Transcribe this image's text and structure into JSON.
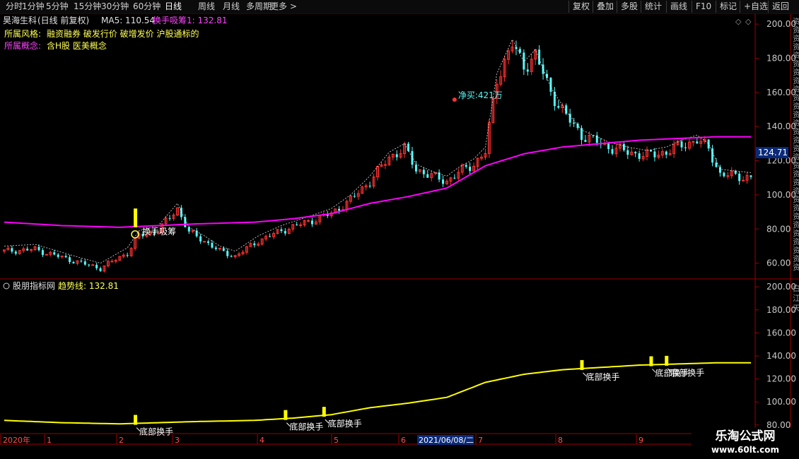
{
  "toolbar": {
    "left_items": [
      "分时",
      "1分钟",
      "5分钟",
      "15分钟",
      "30分钟",
      "60分钟",
      "日线",
      "周线",
      "月线",
      "多周期",
      "更多 >"
    ],
    "active": "日线",
    "right_items": [
      "复权",
      "叠加",
      "多股",
      "统计",
      "画线",
      "F10",
      "标记",
      "+自选",
      "返回"
    ]
  },
  "main_panel": {
    "stock_name": "昊海生科",
    "period": "(日线 前复权)",
    "ma5_label": "MA5: 110.54",
    "indicator_label": "换手吸筹1: 132.81",
    "style_label": "所属风格:",
    "style_value": "融资融券 破发行价 破增发价 沪股通标的",
    "concept_label": "所属概念:",
    "concept_value": "含H股 医美概念",
    "annotation_buy": "净买:421万",
    "annotation_signal": "换手吸筹",
    "current_price_tag": "124.71",
    "colors": {
      "up": "#ff3232",
      "down": "#54fcfc",
      "ma": "#ff00ff",
      "annotation": "#ffff00",
      "text_yellow": "#ffff54"
    }
  },
  "sub_panel": {
    "name": "股朋指标网",
    "trend_label": "趋势线: 132.81",
    "signal_label": "底部换手",
    "right_labels": [
      "白",
      "江",
      "天"
    ]
  },
  "right_side_text": [
    "资",
    "资",
    "资",
    "资",
    "资",
    "资",
    "资",
    "资",
    "资",
    "资",
    "资",
    "资",
    "资",
    "资",
    "资",
    "资",
    "资",
    "资",
    "资",
    "资",
    "资",
    "资",
    "资",
    "资",
    "资",
    "资",
    "资",
    "资",
    "资",
    "资"
  ],
  "x_axis": [
    "2020年",
    "1",
    "2",
    "3",
    "4",
    "5",
    "6",
    "2021/06/08/二",
    "7",
    "8",
    "9"
  ],
  "watermark": {
    "title": "乐淘公式网",
    "url": "www.60lt.com"
  },
  "chart_data": [
    {
      "type": "candlestick",
      "title": "昊海生科 (日线 前复权)",
      "ylim": [
        52,
        205
      ],
      "yticks": [
        60,
        80,
        100,
        120,
        140,
        160,
        180,
        200
      ],
      "ytick_labels": [
        "60.00",
        "80.00",
        "100.00",
        "120.00",
        "140.00",
        "160.00",
        "180.00",
        "200.00"
      ],
      "x_count": 195,
      "close_anchors": [
        [
          0,
          67
        ],
        [
          8,
          68
        ],
        [
          14,
          64
        ],
        [
          20,
          60
        ],
        [
          25,
          57
        ],
        [
          32,
          66
        ],
        [
          35,
          76
        ],
        [
          40,
          79
        ],
        [
          45,
          92
        ],
        [
          48,
          78
        ],
        [
          52,
          73
        ],
        [
          56,
          67
        ],
        [
          60,
          64
        ],
        [
          66,
          73
        ],
        [
          72,
          79
        ],
        [
          76,
          82
        ],
        [
          80,
          85
        ],
        [
          85,
          89
        ],
        [
          90,
          97
        ],
        [
          95,
          108
        ],
        [
          100,
          122
        ],
        [
          104,
          127
        ],
        [
          107,
          115
        ],
        [
          112,
          110
        ],
        [
          115,
          108
        ],
        [
          118,
          113
        ],
        [
          122,
          118
        ],
        [
          125,
          125
        ],
        [
          128,
          168
        ],
        [
          132,
          188
        ],
        [
          135,
          175
        ],
        [
          138,
          182
        ],
        [
          142,
          160
        ],
        [
          146,
          146
        ],
        [
          150,
          135
        ],
        [
          153,
          132
        ],
        [
          157,
          128
        ],
        [
          162,
          125
        ],
        [
          167,
          123
        ],
        [
          172,
          125
        ],
        [
          176,
          129
        ],
        [
          180,
          132
        ],
        [
          183,
          127
        ],
        [
          186,
          112
        ],
        [
          190,
          111
        ],
        [
          194,
          110
        ]
      ],
      "series": [
        {
          "name": "MA",
          "values_anchor": [
            [
              0,
              84
            ],
            [
              15,
              82
            ],
            [
              30,
              81
            ],
            [
              50,
              83
            ],
            [
              65,
              84
            ],
            [
              75,
              86
            ],
            [
              85,
              89
            ],
            [
              95,
              95
            ],
            [
              105,
              99
            ],
            [
              115,
              104
            ],
            [
              125,
              117
            ],
            [
              135,
              124
            ],
            [
              145,
              128
            ],
            [
              155,
              130
            ],
            [
              165,
              132
            ],
            [
              175,
              133
            ],
            [
              185,
              134
            ],
            [
              194,
              134
            ]
          ]
        }
      ],
      "current_price": 124.71
    },
    {
      "type": "line",
      "title": "股朋指标网",
      "ylim": [
        75,
        205
      ],
      "yticks": [
        80,
        100,
        120,
        140,
        160,
        180,
        200
      ],
      "ytick_labels": [
        "80.00",
        "100.00",
        "120.00",
        "140.00",
        "160.00",
        "180.00",
        "200.00"
      ],
      "series": [
        {
          "name": "趋势线",
          "values_anchor": [
            [
              0,
              84
            ],
            [
              15,
              82
            ],
            [
              30,
              81
            ],
            [
              50,
              83
            ],
            [
              65,
              84
            ],
            [
              75,
              86
            ],
            [
              85,
              89
            ],
            [
              95,
              95
            ],
            [
              105,
              99
            ],
            [
              115,
              104
            ],
            [
              125,
              117
            ],
            [
              135,
              124
            ],
            [
              145,
              128
            ],
            [
              155,
              130
            ],
            [
              165,
              132
            ],
            [
              175,
              133
            ],
            [
              185,
              134
            ],
            [
              194,
              134
            ]
          ]
        }
      ],
      "signals": [
        34,
        73,
        83,
        150,
        168,
        172
      ]
    }
  ]
}
